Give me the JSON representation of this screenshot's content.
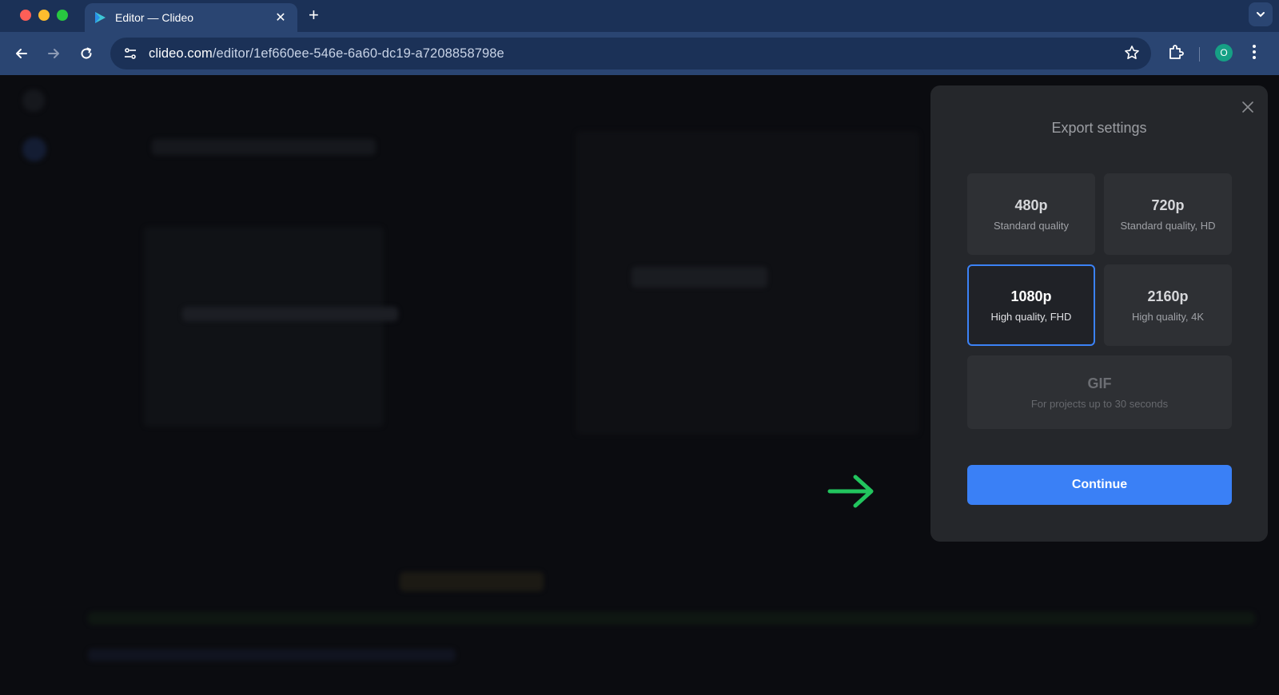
{
  "browser": {
    "tab_title": "Editor — Clideo",
    "url_host": "clideo.com",
    "url_path": "/editor/1ef660ee-546e-6a60-dc19-a7208858798e",
    "profile_initial": "O"
  },
  "modal": {
    "title": "Export settings",
    "options": [
      {
        "resolution": "480p",
        "description": "Standard quality",
        "state": "default"
      },
      {
        "resolution": "720p",
        "description": "Standard quality, HD",
        "state": "default"
      },
      {
        "resolution": "1080p",
        "description": "High quality, FHD",
        "state": "selected"
      },
      {
        "resolution": "2160p",
        "description": "High quality, 4K",
        "state": "default"
      },
      {
        "resolution": "GIF",
        "description": "For projects up to 30 seconds",
        "state": "disabled"
      }
    ],
    "continue_label": "Continue"
  },
  "colors": {
    "accent": "#3a80f6",
    "selected_border": "#3b82f6",
    "arrow": "#22c55e",
    "chrome": "#2a4572"
  },
  "icons": {
    "tab_logo": "play-triangle-icon",
    "close": "close-icon",
    "arrow": "arrow-right-icon"
  }
}
